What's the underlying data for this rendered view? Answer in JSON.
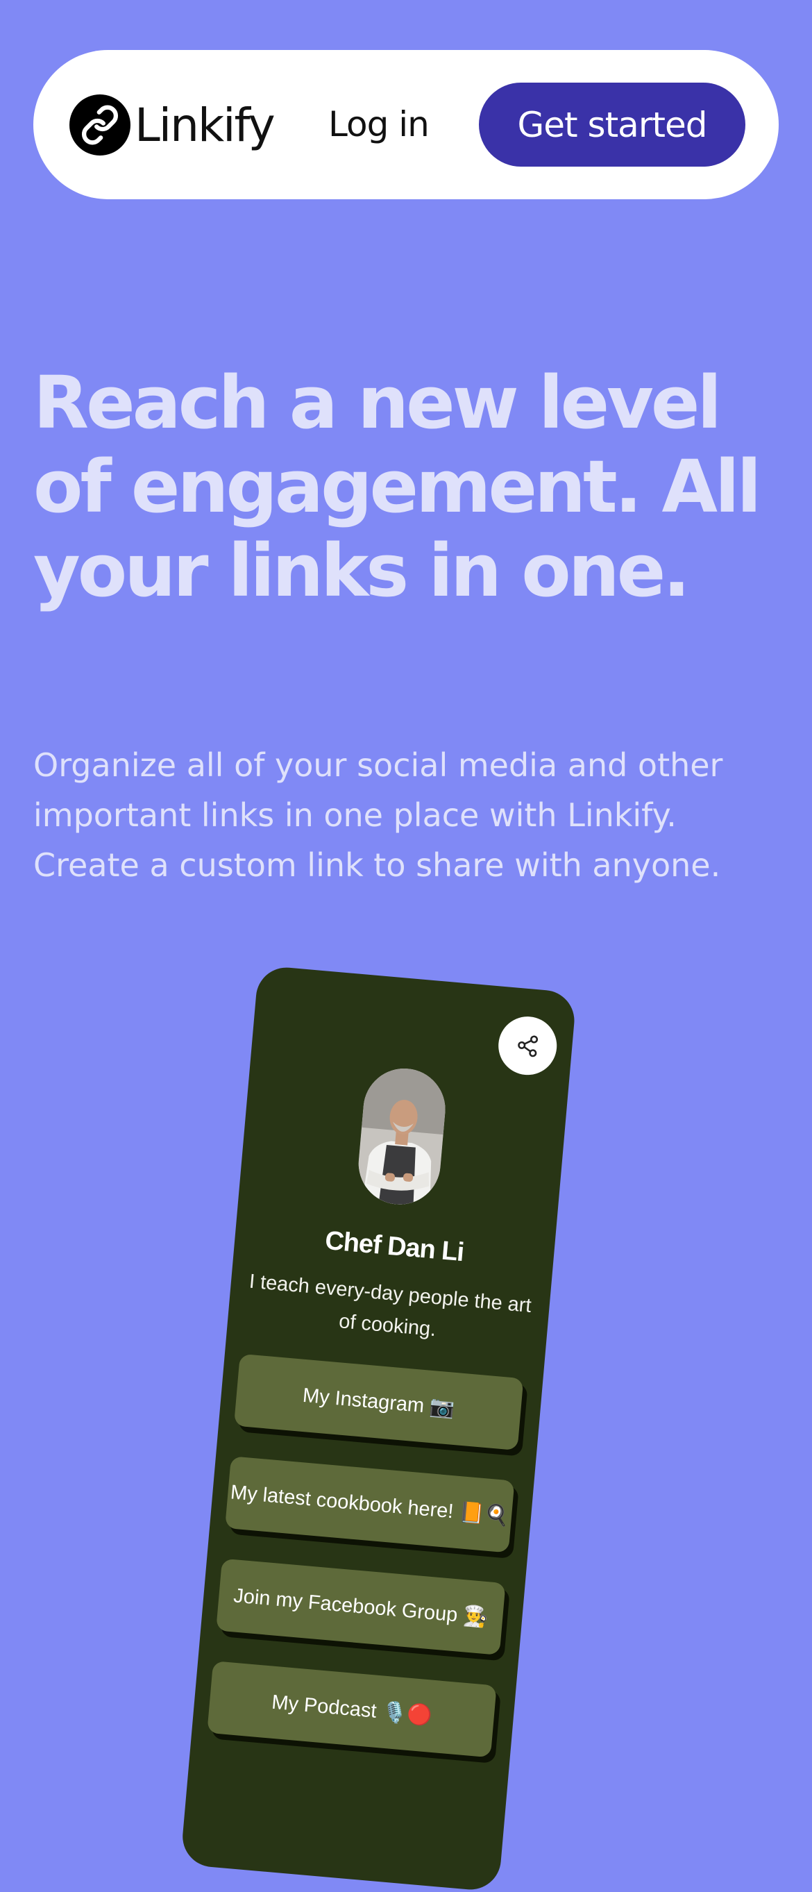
{
  "nav": {
    "brand": "Linkify",
    "login_label": "Log in",
    "cta_label": "Get started"
  },
  "hero": {
    "headline": "Reach a new level of engagement. All your links in one.",
    "subheadline": "Organize all of your social media and other important links in one place with Linkify. Create a custom link to share with anyone."
  },
  "mockup": {
    "name": "Chef Dan Li",
    "bio": "I teach every-day people the art of cooking.",
    "links": [
      {
        "label": "My Instagram 📷"
      },
      {
        "label": "My latest cookbook here! 📙🍳"
      },
      {
        "label": "Join my Facebook Group 👨‍🍳"
      },
      {
        "label": "My Podcast 🎙️🔴"
      }
    ]
  },
  "colors": {
    "background": "#8089f5",
    "cta": "#3a32a8",
    "phone": "#283515",
    "link_button": "#5e6a3a",
    "hero_text": "#dfe1fb"
  },
  "icons": {
    "brand": "link-chain-icon",
    "share": "share-icon"
  }
}
